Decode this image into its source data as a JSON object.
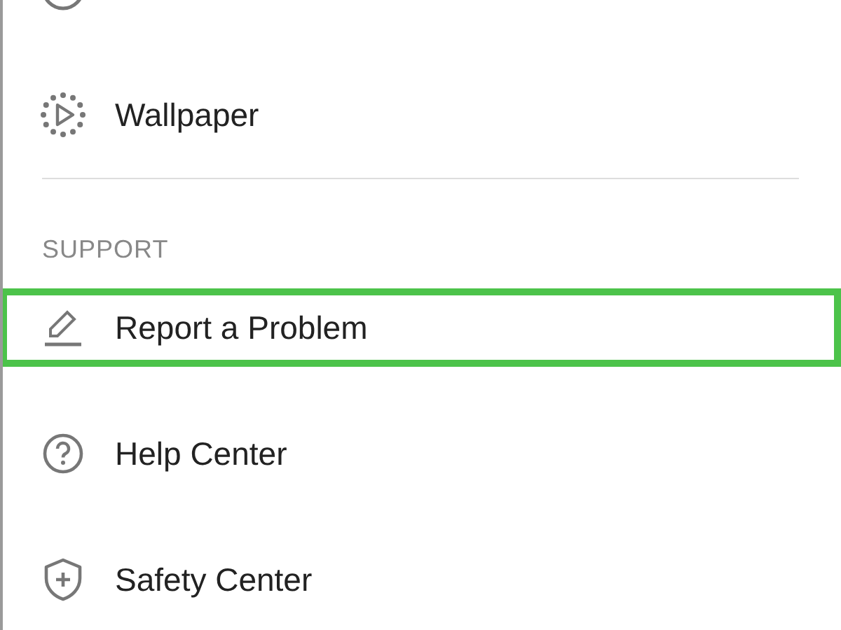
{
  "items_top": [
    {
      "label": "Wallpaper",
      "selected": false
    }
  ],
  "section": {
    "title": "SUPPORT",
    "items": [
      {
        "label": "Report a Problem",
        "selected": true
      },
      {
        "label": "Help Center",
        "selected": false
      },
      {
        "label": "Safety Center",
        "selected": false
      }
    ]
  }
}
